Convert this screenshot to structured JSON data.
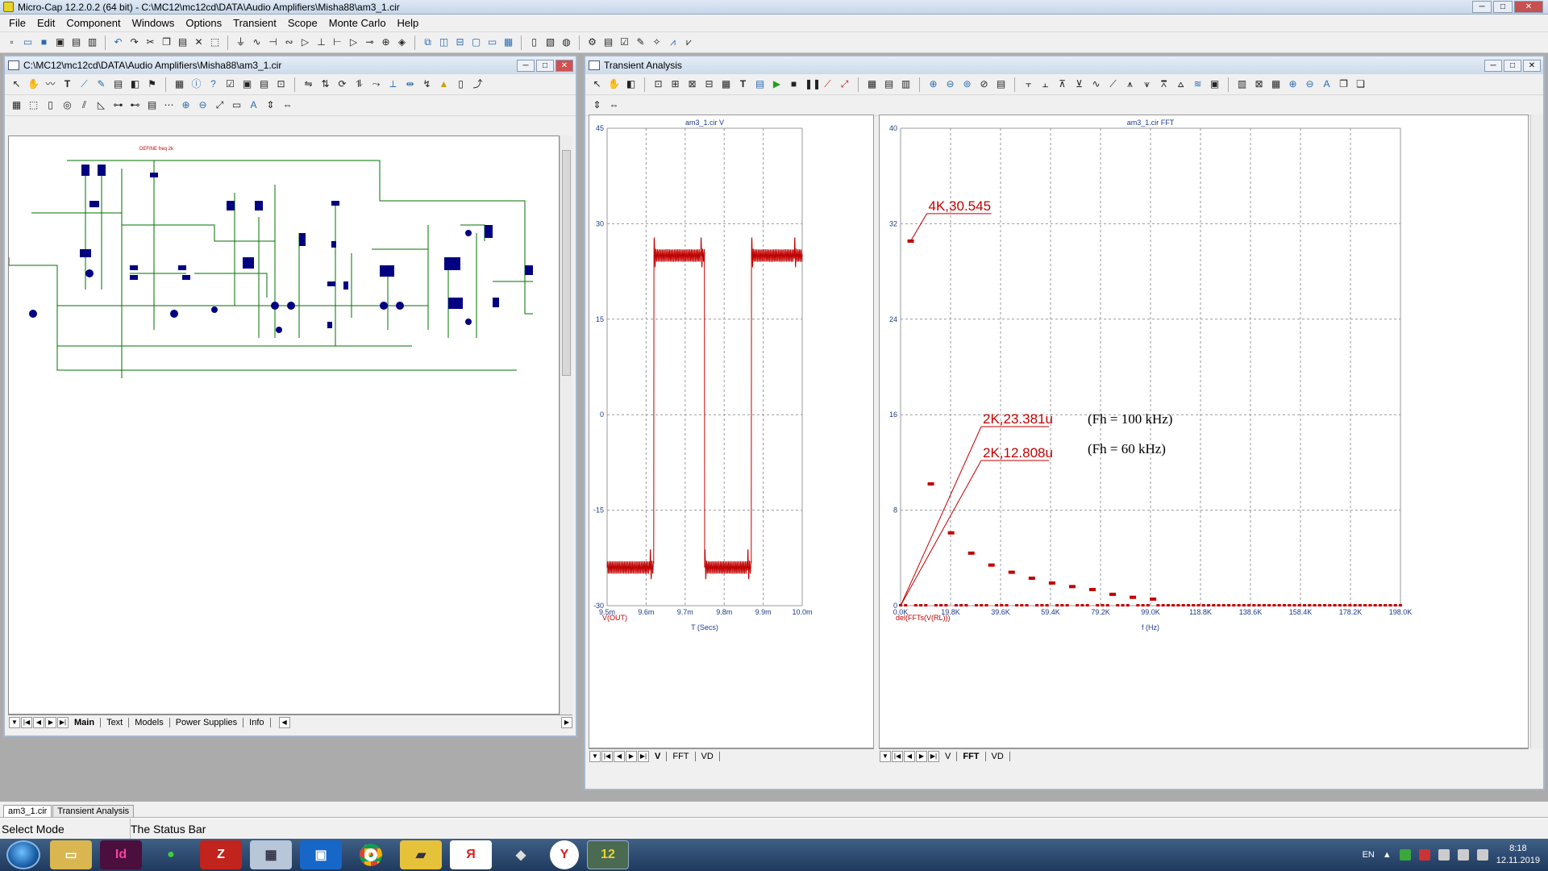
{
  "app": {
    "title": "Micro-Cap 12.2.0.2 (64 bit) - C:\\MC12\\mc12cd\\DATA\\Audio Amplifiers\\Misha88\\am3_1.cir"
  },
  "window_buttons": {
    "minimize": "─",
    "maximize": "□",
    "close": "✕"
  },
  "menu": [
    "File",
    "Edit",
    "Component",
    "Windows",
    "Options",
    "Transient",
    "Scope",
    "Monte Carlo",
    "Help"
  ],
  "schematic_window": {
    "title": "C:\\MC12\\mc12cd\\DATA\\Audio Amplifiers\\Misha88\\am3_1.cir",
    "define_label": "DEFINE freq 2k",
    "tabs": [
      "Main",
      "Text",
      "Models",
      "Power Supplies",
      "Info"
    ],
    "active_tab": "Main"
  },
  "analysis_window": {
    "title": "Transient Analysis"
  },
  "plot_left": {
    "title": "am3_1.cir V",
    "xlabel": "T (Secs)",
    "ylabel_expr": "V(OUT)",
    "x_ticks": [
      "9.5m",
      "9.6m",
      "9.7m",
      "9.8m",
      "9.9m",
      "10.0m"
    ],
    "y_ticks": [
      "45",
      "30",
      "15",
      "0",
      "-15",
      "-30"
    ],
    "tabs": [
      "V",
      "FFT",
      "VD"
    ],
    "active_tab": "V"
  },
  "plot_right": {
    "title": "am3_1.cir FFT",
    "xlabel": "f (Hz)",
    "ylabel_expr": "del(FFTs(V(RL)))",
    "x_ticks": [
      "0.0K",
      "19.8K",
      "39.6K",
      "59.4K",
      "79.2K",
      "99.0K",
      "118.8K",
      "138.6K",
      "158.4K",
      "178.2K",
      "198.0K"
    ],
    "y_ticks": [
      "40",
      "32",
      "24",
      "16",
      "8",
      "0"
    ],
    "tabs": [
      "V",
      "FFT",
      "VD"
    ],
    "active_tab": "FFT",
    "annotations": {
      "peak": "4K,30.545",
      "a1": "2K,23.381u",
      "a2": "2K,12.808u",
      "note1": "(Fh = 100 kHz)",
      "note2": "(Fh = 60 kHz)"
    }
  },
  "chart_data": [
    {
      "type": "line",
      "title": "am3_1.cir V",
      "xlabel": "T (Secs)",
      "ylabel": "V(OUT)",
      "xlim": [
        0.0095,
        0.01
      ],
      "ylim": [
        -30,
        45
      ],
      "x_ticks": [
        "9.5m",
        "9.6m",
        "9.7m",
        "9.8m",
        "9.9m",
        "10.0m"
      ],
      "y_ticks": [
        45,
        30,
        15,
        0,
        -15,
        -30
      ],
      "grid": true,
      "series": [
        {
          "name": "V(OUT)",
          "color": "#c00000",
          "shape": "square wave with ringing",
          "x": [
            0.0095,
            0.00961,
            0.00962,
            0.00974,
            0.00975,
            0.00986,
            0.00987,
            0.00998
          ],
          "y": [
            -24,
            -24,
            25,
            25,
            -24,
            -24,
            25,
            25
          ]
        }
      ]
    },
    {
      "type": "scatter",
      "title": "am3_1.cir FFT",
      "xlabel": "f (Hz)",
      "ylabel": "del(FFTs(V(RL)))",
      "xlim": [
        0,
        198000
      ],
      "ylim": [
        0,
        40
      ],
      "x_ticks": [
        "0.0K",
        "19.8K",
        "39.6K",
        "59.4K",
        "79.2K",
        "99.0K",
        "118.8K",
        "138.6K",
        "158.4K",
        "178.2K",
        "198.0K"
      ],
      "y_ticks": [
        40,
        32,
        24,
        16,
        8,
        0
      ],
      "grid": true,
      "series": [
        {
          "name": "del(FFTs(V(RL)))",
          "color": "#c00000",
          "x": [
            4000,
            12000,
            20000,
            28000,
            36000,
            44000,
            52000,
            60000,
            68000,
            76000,
            84000,
            92000,
            100000
          ],
          "y": [
            30.545,
            10.2,
            6.1,
            4.4,
            3.4,
            2.8,
            2.3,
            1.9,
            1.6,
            1.35,
            0.95,
            0.7,
            0.55
          ]
        }
      ],
      "annotations": [
        "4K,30.545",
        "2K,23.381u",
        "2K,12.808u",
        "(Fh = 100 kHz)",
        "(Fh = 60 kHz)"
      ]
    }
  ],
  "doc_tabs": [
    "am3_1.cir",
    "Transient Analysis"
  ],
  "status": {
    "mode": "Select Mode",
    "text": "The Status Bar"
  },
  "taskbar": {
    "lang": "EN",
    "time": "8:18",
    "date": "12.11.2019"
  },
  "colors": {
    "trace": "#c00000",
    "wire": "#007000",
    "component": "#000080",
    "grid": "#9a9a9a"
  }
}
